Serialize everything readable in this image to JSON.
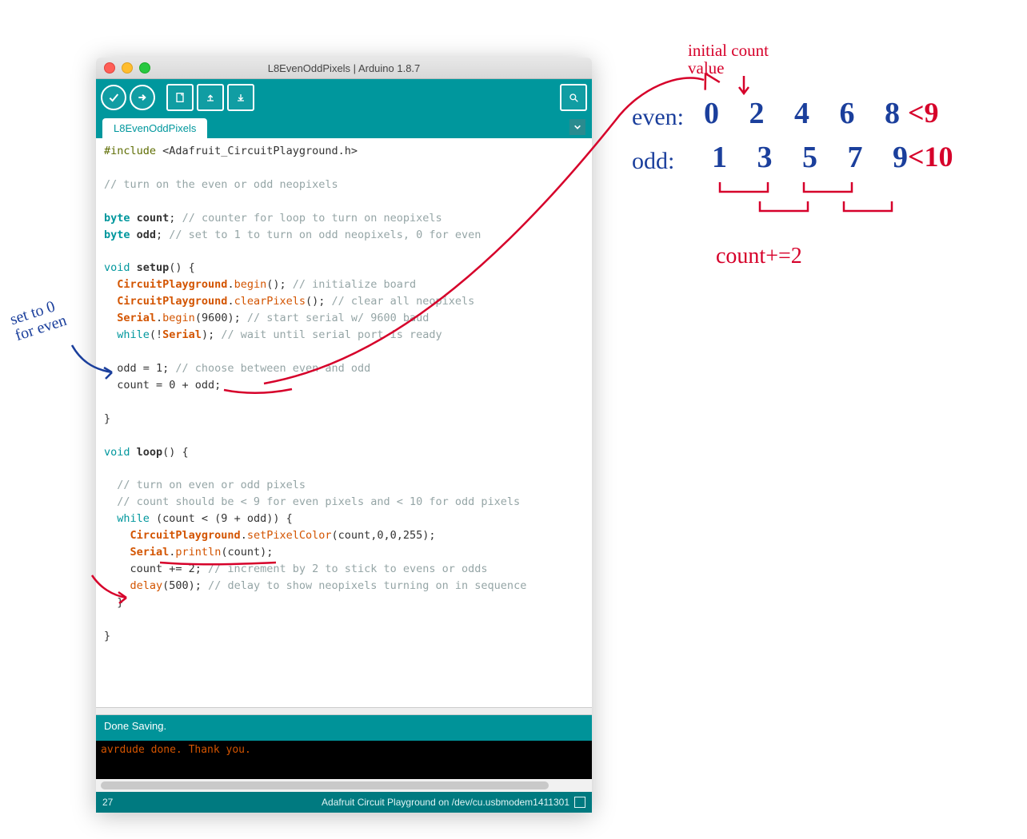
{
  "window": {
    "title": "L8EvenOddPixels | Arduino 1.8.7",
    "tab": "L8EvenOddPixels"
  },
  "status": {
    "text": "Done Saving."
  },
  "console": {
    "line1": "avrdude done.  Thank you."
  },
  "footer": {
    "line_number": "27",
    "board": "Adafruit Circuit Playground on /dev/cu.usbmodem1411301"
  },
  "code": {
    "l1_pre": "#include",
    "l1_rest": " <Adafruit_CircuitPlayground.h>",
    "l3_cmt": "// turn on the even or odd neopixels",
    "l5_type": "byte",
    "l5_var": " count",
    "l5_rest": "; ",
    "l5_cmt": "// counter for loop to turn on neopixels",
    "l6_type": "byte",
    "l6_var": " odd",
    "l6_rest": "; ",
    "l6_cmt": "// set to 1 to turn on odd neopixels, 0 for even",
    "l8_kw": "void",
    "l8_fn": " setup",
    "l8_rest": "() {",
    "l9_obj": "  CircuitPlayground",
    "l9_dot": ".",
    "l9_fn": "begin",
    "l9_rest": "(); ",
    "l9_cmt": "// initialize board",
    "l10_obj": "  CircuitPlayground",
    "l10_dot": ".",
    "l10_fn": "clearPixels",
    "l10_rest": "(); ",
    "l10_cmt": "// clear all neopixels",
    "l11_obj": "  Serial",
    "l11_dot": ".",
    "l11_fn": "begin",
    "l11_args": "(9600); ",
    "l11_cmt": "// start serial w/ 9600 baud",
    "l12_kw": "  while",
    "l12_rest1": "(!",
    "l12_obj": "Serial",
    "l12_rest2": "); ",
    "l12_cmt": "// wait until serial port is ready",
    "l14": "  odd = 1; ",
    "l14_cmt": "// choose between even and odd",
    "l15": "  count = 0 + odd;",
    "l17": "}",
    "l19_kw": "void",
    "l19_fn": " loop",
    "l19_rest": "() {",
    "l21_cmt": "  // turn on even or odd pixels",
    "l22_cmt": "  // count should be < 9 for even pixels and < 10 for odd pixels",
    "l23_kw": "  while",
    "l23_rest": " (count < (9 + odd)) {",
    "l24_obj": "    CircuitPlayground",
    "l24_dot": ".",
    "l24_fn": "setPixelColor",
    "l24_args": "(count,0,0,255);",
    "l25_obj": "    Serial",
    "l25_dot": ".",
    "l25_fn": "println",
    "l25_args": "(count);",
    "l26": "    count += 2; ",
    "l26_cmt": "// increment by 2 to stick to evens or odds",
    "l27_fn": "    delay",
    "l27_args": "(500); ",
    "l27_cmt": "// delay to show neopixels turning on in sequence",
    "l28": "  }",
    "l30": "}"
  },
  "annotations": {
    "set_forever": "set to 0\nfor even",
    "initial": "initial count\nvalue",
    "even_label": "even:",
    "odd_label": "odd:",
    "even_vals": "0 2 4 6 8",
    "even_lim": "<9",
    "odd_vals": "1 3 5 7 9",
    "odd_lim": "<10",
    "inc": "count+=2"
  }
}
